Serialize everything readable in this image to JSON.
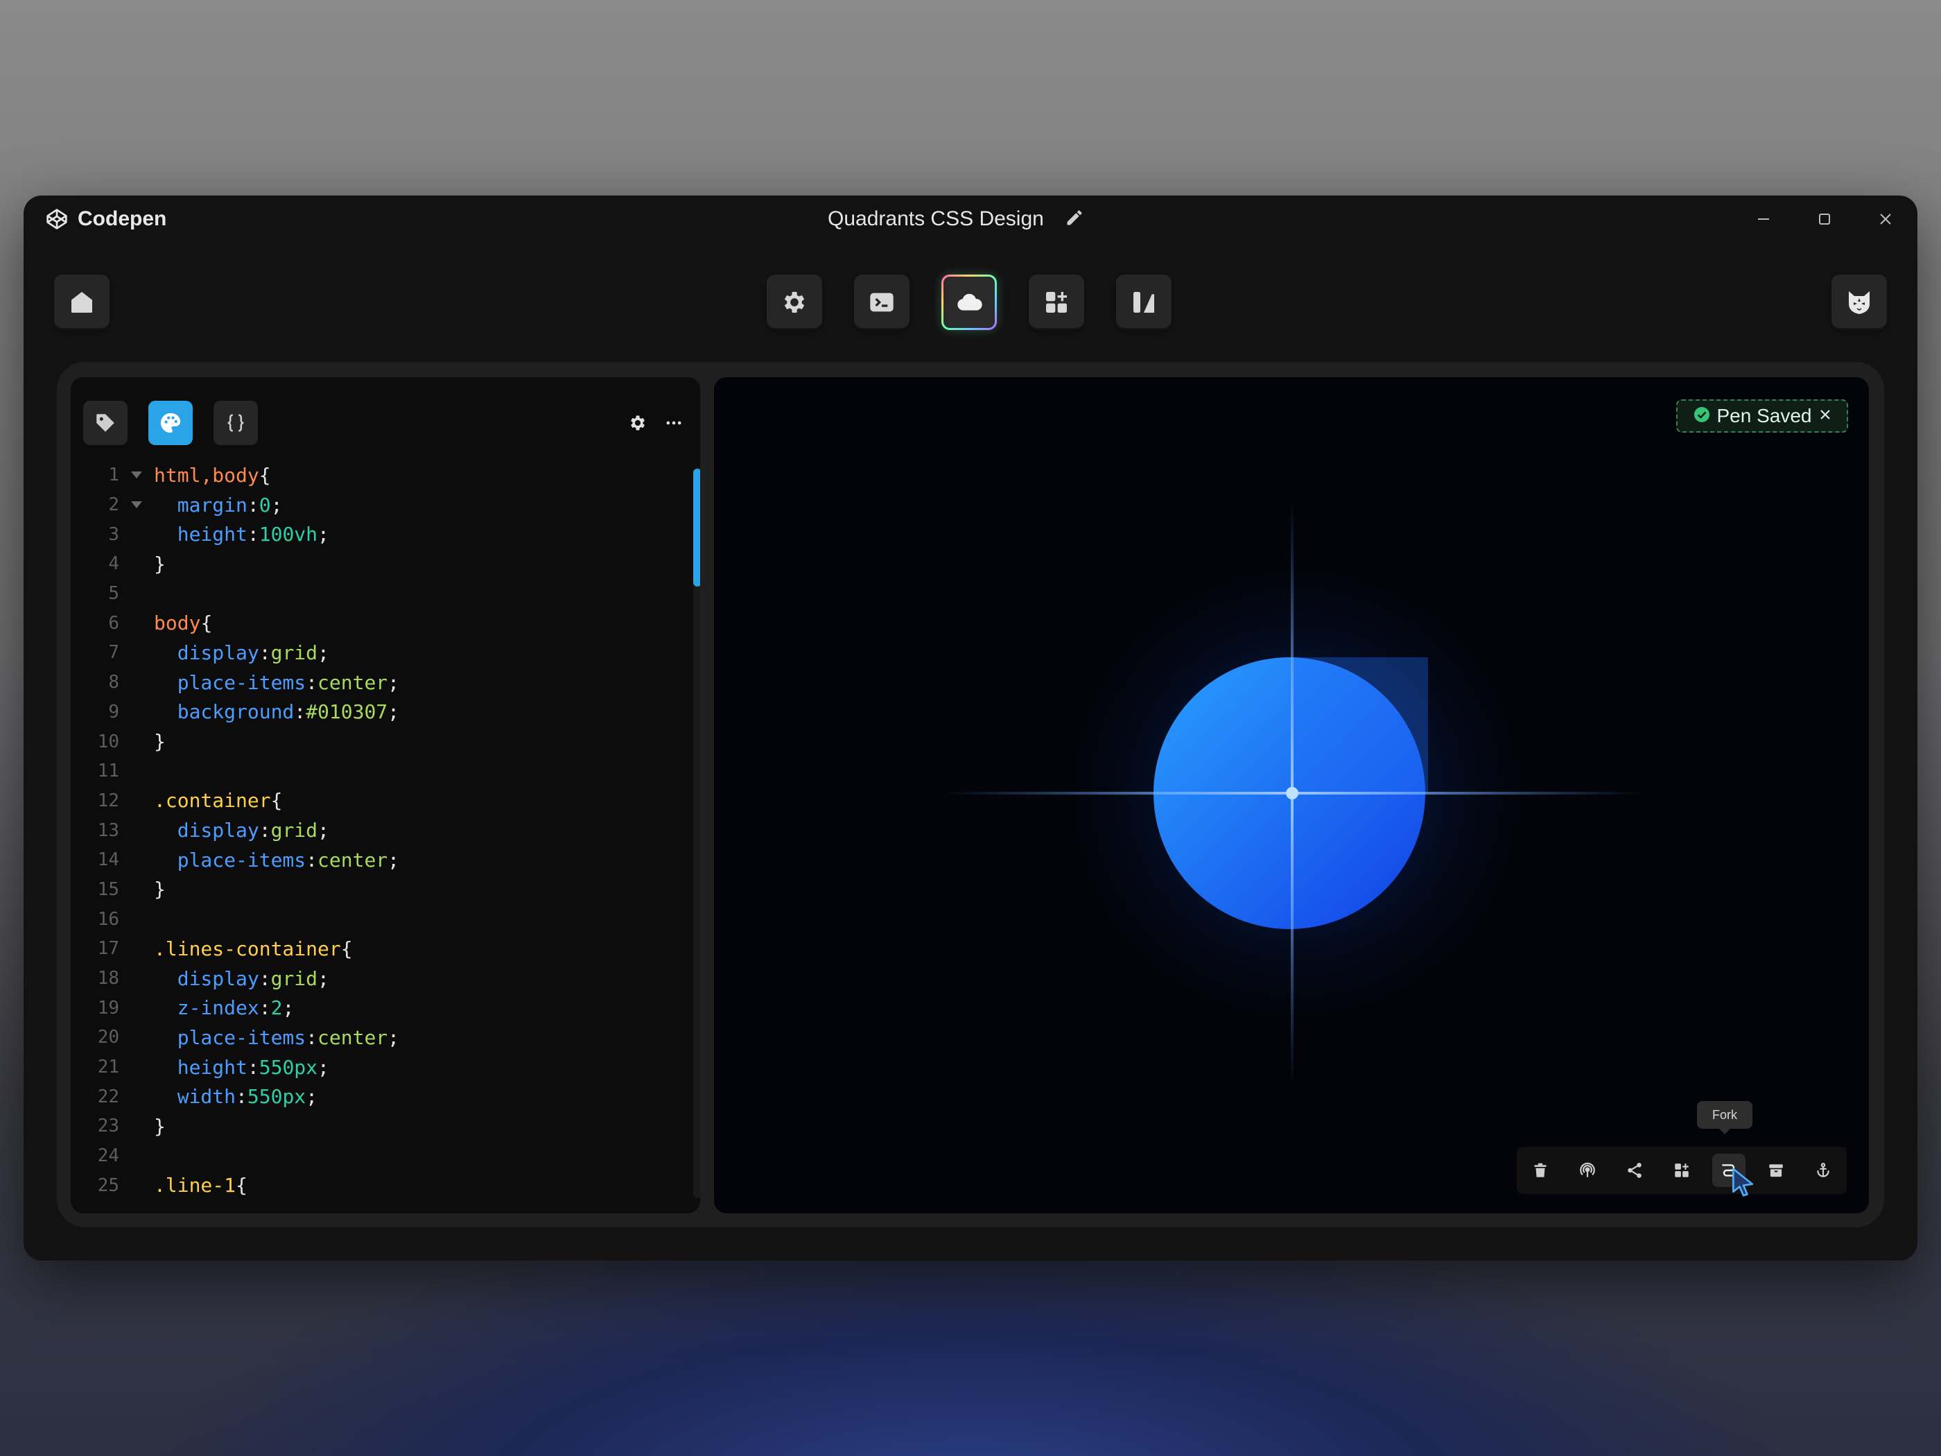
{
  "app": {
    "name": "Codepen",
    "document_title": "Quadrants CSS Design"
  },
  "window_controls": [
    "minimize-icon",
    "maximize-icon",
    "close-icon"
  ],
  "toolbar": {
    "left": {
      "icon": "home-icon"
    },
    "center": [
      {
        "icon": "gear-icon",
        "active": false
      },
      {
        "icon": "terminal-icon",
        "active": false
      },
      {
        "icon": "cloud-icon",
        "active": true
      },
      {
        "icon": "grid-add-icon",
        "active": false
      },
      {
        "icon": "layout-icon",
        "active": false
      }
    ],
    "right": {
      "icon": "avatar-cat"
    }
  },
  "editor": {
    "tabs": [
      {
        "icon": "tag-icon",
        "lang": "HTML",
        "active": false
      },
      {
        "icon": "palette-icon",
        "lang": "CSS",
        "active": true
      },
      {
        "icon": "braces-icon",
        "lang": "JS",
        "active": false
      }
    ],
    "actions": [
      "gear-icon",
      "more-icon"
    ],
    "lines": [
      {
        "n": "1",
        "fold": true,
        "tokens": [
          [
            "sel",
            "html,body"
          ],
          [
            "pun",
            "{"
          ]
        ]
      },
      {
        "n": "2",
        "fold": true,
        "tokens": [
          [
            "sp",
            "  "
          ],
          [
            "prop",
            "margin"
          ],
          [
            "pun",
            ":"
          ],
          [
            "val",
            "0"
          ],
          [
            "pun",
            ";"
          ]
        ]
      },
      {
        "n": "3",
        "fold": false,
        "tokens": [
          [
            "sp",
            "  "
          ],
          [
            "prop",
            "height"
          ],
          [
            "pun",
            ":"
          ],
          [
            "val",
            "100vh"
          ],
          [
            "pun",
            ";"
          ]
        ]
      },
      {
        "n": "4",
        "fold": false,
        "tokens": [
          [
            "pun",
            "}"
          ]
        ]
      },
      {
        "n": "5",
        "fold": false,
        "tokens": []
      },
      {
        "n": "6",
        "fold": false,
        "tokens": [
          [
            "sel",
            "body"
          ],
          [
            "pun",
            "{"
          ]
        ]
      },
      {
        "n": "7",
        "fold": false,
        "tokens": [
          [
            "sp",
            "  "
          ],
          [
            "prop",
            "display"
          ],
          [
            "pun",
            ":"
          ],
          [
            "kw",
            "grid"
          ],
          [
            "pun",
            ";"
          ]
        ]
      },
      {
        "n": "8",
        "fold": false,
        "tokens": [
          [
            "sp",
            "  "
          ],
          [
            "prop",
            "place-items"
          ],
          [
            "pun",
            ":"
          ],
          [
            "kw",
            "center"
          ],
          [
            "pun",
            ";"
          ]
        ]
      },
      {
        "n": "9",
        "fold": false,
        "tokens": [
          [
            "sp",
            "  "
          ],
          [
            "prop",
            "background"
          ],
          [
            "pun",
            ":"
          ],
          [
            "kw",
            "#010307"
          ],
          [
            "pun",
            ";"
          ]
        ]
      },
      {
        "n": "10",
        "fold": false,
        "tokens": [
          [
            "pun",
            "}"
          ]
        ]
      },
      {
        "n": "11",
        "fold": false,
        "tokens": []
      },
      {
        "n": "12",
        "fold": false,
        "tokens": [
          [
            "cls",
            ".container"
          ],
          [
            "pun",
            "{"
          ]
        ]
      },
      {
        "n": "13",
        "fold": false,
        "tokens": [
          [
            "sp",
            "  "
          ],
          [
            "prop",
            "display"
          ],
          [
            "pun",
            ":"
          ],
          [
            "kw",
            "grid"
          ],
          [
            "pun",
            ";"
          ]
        ]
      },
      {
        "n": "14",
        "fold": false,
        "tokens": [
          [
            "sp",
            "  "
          ],
          [
            "prop",
            "place-items"
          ],
          [
            "pun",
            ":"
          ],
          [
            "kw",
            "center"
          ],
          [
            "pun",
            ";"
          ]
        ]
      },
      {
        "n": "15",
        "fold": false,
        "tokens": [
          [
            "pun",
            "}"
          ]
        ]
      },
      {
        "n": "16",
        "fold": false,
        "tokens": []
      },
      {
        "n": "17",
        "fold": false,
        "tokens": [
          [
            "cls",
            ".lines-container"
          ],
          [
            "pun",
            "{"
          ]
        ]
      },
      {
        "n": "18",
        "fold": false,
        "tokens": [
          [
            "sp",
            "  "
          ],
          [
            "prop",
            "display"
          ],
          [
            "pun",
            ":"
          ],
          [
            "kw",
            "grid"
          ],
          [
            "pun",
            ";"
          ]
        ]
      },
      {
        "n": "19",
        "fold": false,
        "tokens": [
          [
            "sp",
            "  "
          ],
          [
            "prop",
            "z-index"
          ],
          [
            "pun",
            ":"
          ],
          [
            "val",
            "2"
          ],
          [
            "pun",
            ";"
          ]
        ]
      },
      {
        "n": "20",
        "fold": false,
        "tokens": [
          [
            "sp",
            "  "
          ],
          [
            "prop",
            "place-items"
          ],
          [
            "pun",
            ":"
          ],
          [
            "kw",
            "center"
          ],
          [
            "pun",
            ";"
          ]
        ]
      },
      {
        "n": "21",
        "fold": false,
        "tokens": [
          [
            "sp",
            "  "
          ],
          [
            "prop",
            "height"
          ],
          [
            "pun",
            ":"
          ],
          [
            "val",
            "550px"
          ],
          [
            "pun",
            ";"
          ]
        ]
      },
      {
        "n": "22",
        "fold": false,
        "tokens": [
          [
            "sp",
            "  "
          ],
          [
            "prop",
            "width"
          ],
          [
            "pun",
            ":"
          ],
          [
            "val",
            "550px"
          ],
          [
            "pun",
            ";"
          ]
        ]
      },
      {
        "n": "23",
        "fold": false,
        "tokens": [
          [
            "pun",
            "}"
          ]
        ]
      },
      {
        "n": "24",
        "fold": false,
        "tokens": []
      },
      {
        "n": "25",
        "fold": false,
        "tokens": [
          [
            "cls",
            ".line-1"
          ],
          [
            "pun",
            "{"
          ]
        ]
      }
    ]
  },
  "preview": {
    "toast": {
      "text": "Pen Saved",
      "icon": "check-circle-icon",
      "close_icon": "close-icon"
    },
    "tooltip": "Fork",
    "actions": [
      {
        "icon": "trash-icon"
      },
      {
        "icon": "broadcast-icon"
      },
      {
        "icon": "share-icon"
      },
      {
        "icon": "grid-add-icon"
      },
      {
        "icon": "fork-icon",
        "hover": true
      },
      {
        "icon": "archive-icon"
      },
      {
        "icon": "anchor-icon"
      }
    ]
  },
  "colors": {
    "accent_blue": "#2aa4e6",
    "toast_border": "#3d7d5a",
    "sphere_light": "#2aa0ff",
    "sphere_dark": "#1240e6"
  }
}
